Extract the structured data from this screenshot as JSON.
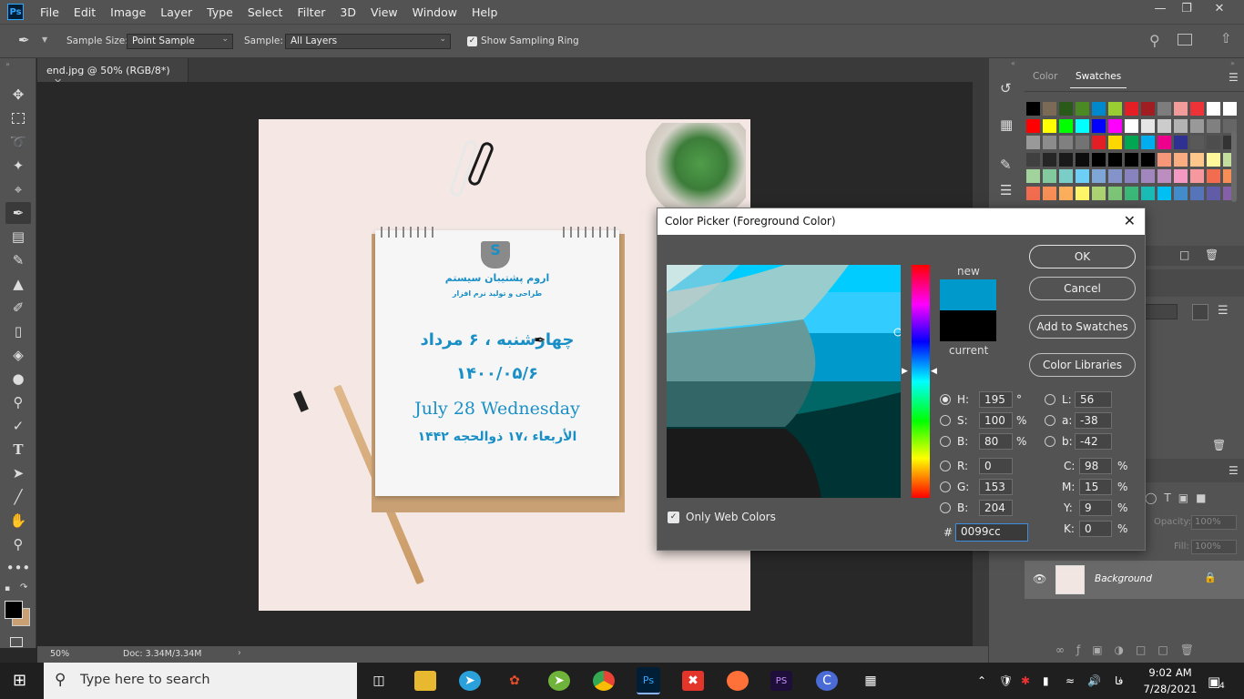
{
  "app": {
    "menu": [
      "File",
      "Edit",
      "Image",
      "Layer",
      "Type",
      "Select",
      "Filter",
      "3D",
      "View",
      "Window",
      "Help"
    ]
  },
  "options": {
    "sample_size_label": "Sample Size:",
    "sample_size_value": "Point Sample",
    "sample_label": "Sample:",
    "sample_value": "All Layers",
    "show_ring_label": "Show Sampling Ring",
    "show_ring_checked": true
  },
  "document": {
    "tab_title": "end.jpg @ 50% (RGB/8*)",
    "zoom": "50%",
    "doc_info": "Doc: 3.34M/3.34M"
  },
  "image_text": {
    "company_name": "اروم پشتیبان سیستم",
    "company_tagline": "طراحی و تولید نرم افزار",
    "persian_date": "چهارشنبه ، ۶ مرداد",
    "persian_numeric": "۱۴۰۰/۰۵/۶",
    "english_date": "July 28 Wednesday",
    "arabic_date": "الأربعاء ،۱۷ ذوالحجه ۱۴۴۲"
  },
  "panels": {
    "tab_color": "Color",
    "tab_swatches": "Swatches",
    "layers_tab_partial": "ths",
    "opacity_label": "Opacity:",
    "opacity_value": "100%",
    "fill_label": "Fill:",
    "fill_value": "100%",
    "layer_name": "Background"
  },
  "swatches": [
    [
      "#000000",
      "#7b6a56",
      "#2a5a1a",
      "#4b8a22",
      "#0088cc",
      "#9acd32",
      "#e31e24",
      "#a01d21",
      "#7d7d7d",
      "#f29b9b",
      "#ee3338",
      "#ffffff",
      "#ffffff"
    ],
    [
      "#ff0000",
      "#ffff00",
      "#00ff00",
      "#00ffff",
      "#0000ff",
      "#ff00ff",
      "#ffffff",
      "#e6e6e6",
      "#cccccc",
      "#b3b3b3",
      "#999999",
      "#808080",
      "#666666"
    ],
    [
      "#999999",
      "#8c8c8c",
      "#808080",
      "#737373",
      "#e31e24",
      "#fcd700",
      "#00a651",
      "#00aeef",
      "#ec008c",
      "#2e3192",
      "#595959",
      "#4d4d4d",
      "#333333"
    ],
    [
      "#404040",
      "#262626",
      "#1a1a1a",
      "#0d0d0d",
      "#000000",
      "#000000",
      "#000000",
      "#000000",
      "#f7977a",
      "#f9ad81",
      "#fdc68a",
      "#fff79a",
      "#c4df9b"
    ],
    [
      "#a2d39c",
      "#82ca9d",
      "#7bcdc8",
      "#6ecff6",
      "#7ea7d8",
      "#8493ca",
      "#8882be",
      "#a187be",
      "#bc8dbf",
      "#f49ac2",
      "#f6989d",
      "#f26c4f",
      "#f68e56"
    ],
    [
      "#f26c4f",
      "#f68e56",
      "#fbaf5d",
      "#fff568",
      "#acd372",
      "#7cc576",
      "#3bb878",
      "#1abbb4",
      "#00bff3",
      "#438ccb",
      "#5574b9",
      "#605ca8",
      "#855fa8"
    ]
  ],
  "color_picker": {
    "title": "Color Picker (Foreground Color)",
    "ok": "OK",
    "cancel": "Cancel",
    "add_to_swatches": "Add to Swatches",
    "color_libraries": "Color Libraries",
    "new_label": "new",
    "current_label": "current",
    "new_color": "#0099cc",
    "current_color": "#000000",
    "only_web_colors": "Only Web Colors",
    "only_web_checked": true,
    "hsb": {
      "H": "195",
      "S": "100",
      "B": "80"
    },
    "rgb": {
      "R": "0",
      "G": "153",
      "B": "204"
    },
    "lab": {
      "L": "56",
      "a": "-38",
      "b": "-42"
    },
    "cmyk": {
      "C": "98",
      "M": "15",
      "Y": "9",
      "K": "0"
    },
    "hex": "0099cc",
    "units": {
      "deg": "°",
      "pct": "%"
    }
  },
  "taskbar": {
    "search_placeholder": "Type here to search",
    "time": "9:02 AM",
    "date": "7/28/2021",
    "lang": "فا",
    "notifications": "4"
  }
}
